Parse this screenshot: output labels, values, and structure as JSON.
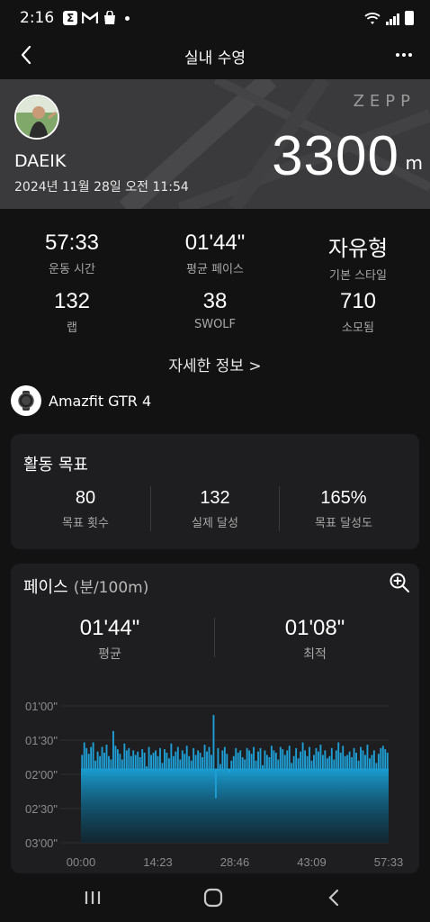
{
  "status_bar": {
    "time": "2:16"
  },
  "header": {
    "title": "실내 수영"
  },
  "hero": {
    "brand": "ZEPP",
    "name": "DAEIK",
    "date": "2024년 11월 28일 오전 11:54",
    "distance": "3300",
    "distance_unit": "m"
  },
  "stats": [
    {
      "value": "57:33",
      "label": "운동 시간"
    },
    {
      "value": "01'44\"",
      "label": "평균 페이스"
    },
    {
      "value": "자유형",
      "label": "기본 스타일"
    },
    {
      "value": "132",
      "label": "랩"
    },
    {
      "value": "38",
      "label": "SWOLF"
    },
    {
      "value": "710",
      "label": "소모됨"
    }
  ],
  "detail_link": "자세한 정보 >",
  "device": {
    "name": "Amazfit GTR 4"
  },
  "goal": {
    "title": "활동 목표",
    "items": [
      {
        "value": "80",
        "label": "목표 횟수"
      },
      {
        "value": "132",
        "label": "실제 달성"
      },
      {
        "value": "165%",
        "label": "목표 달성도"
      }
    ]
  },
  "pace": {
    "title": "페이스",
    "unit": "(분/100m)",
    "average": {
      "value": "01'44\"",
      "label": "평균"
    },
    "best": {
      "value": "01'08\"",
      "label": "최적"
    }
  },
  "chart_data": {
    "type": "bar",
    "title": "",
    "y_ticks": [
      "01'00\"",
      "01'30\"",
      "02'00\"",
      "02'30\"",
      "03'00\""
    ],
    "x_ticks": [
      "00:00",
      "14:23",
      "28:46",
      "43:09",
      "57:33"
    ],
    "ylim_seconds_per_100m": [
      60,
      180
    ],
    "y_inverted": true,
    "bar_color": "#1e9fd6",
    "values_seconds_per_100m": [
      103,
      92,
      97,
      102,
      96,
      92,
      108,
      100,
      104,
      96,
      101,
      94,
      104,
      107,
      82,
      95,
      98,
      102,
      107,
      93,
      99,
      97,
      104,
      99,
      103,
      100,
      105,
      98,
      101,
      113,
      96,
      103,
      101,
      99,
      104,
      97,
      110,
      98,
      101,
      106,
      93,
      104,
      100,
      96,
      107,
      99,
      102,
      95,
      104,
      108,
      97,
      103,
      99,
      101,
      105,
      94,
      100,
      96,
      103,
      68,
      140,
      97,
      111,
      99,
      96,
      102,
      118,
      108,
      104,
      97,
      101,
      99,
      105,
      107,
      97,
      99,
      102,
      96,
      108,
      100,
      97,
      112,
      99,
      103,
      105,
      95,
      99,
      101,
      107,
      96,
      98,
      103,
      99,
      95,
      110,
      104,
      97,
      106,
      100,
      92,
      99,
      104,
      96,
      108,
      103,
      97,
      100,
      94,
      103,
      99,
      106,
      104,
      97,
      107,
      99,
      92,
      101,
      95,
      104,
      103,
      100,
      105,
      97,
      101,
      108,
      96,
      99,
      103,
      94,
      106,
      103,
      99,
      110,
      102,
      97,
      95,
      98,
      101
    ]
  }
}
